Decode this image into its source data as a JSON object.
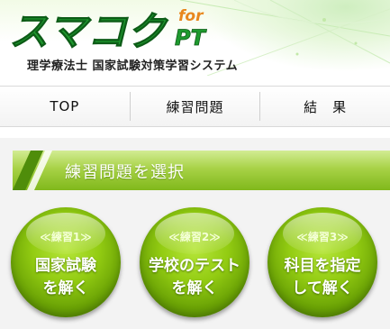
{
  "header": {
    "logo_text": "スマコク",
    "logo_for": "for",
    "logo_pt": "PT",
    "subtitle": "理学療法士 国家試験対策学習システム"
  },
  "nav": {
    "items": [
      {
        "label": "TOP"
      },
      {
        "label": "練習問題"
      },
      {
        "label": "結　果"
      }
    ]
  },
  "section": {
    "title": "練習問題を選択"
  },
  "choices": [
    {
      "tag": "≪練習1≫",
      "line1": "国家試験",
      "line2": "を解く"
    },
    {
      "tag": "≪練習2≫",
      "line1": "学校のテスト",
      "line2": "を解く"
    },
    {
      "tag": "≪練習3≫",
      "line1": "科目を指定",
      "line2": "して解く"
    }
  ],
  "colors": {
    "accent_green": "#8cc63f",
    "logo_green": "#1e9a2e",
    "logo_for_orange": "#e8871e"
  }
}
